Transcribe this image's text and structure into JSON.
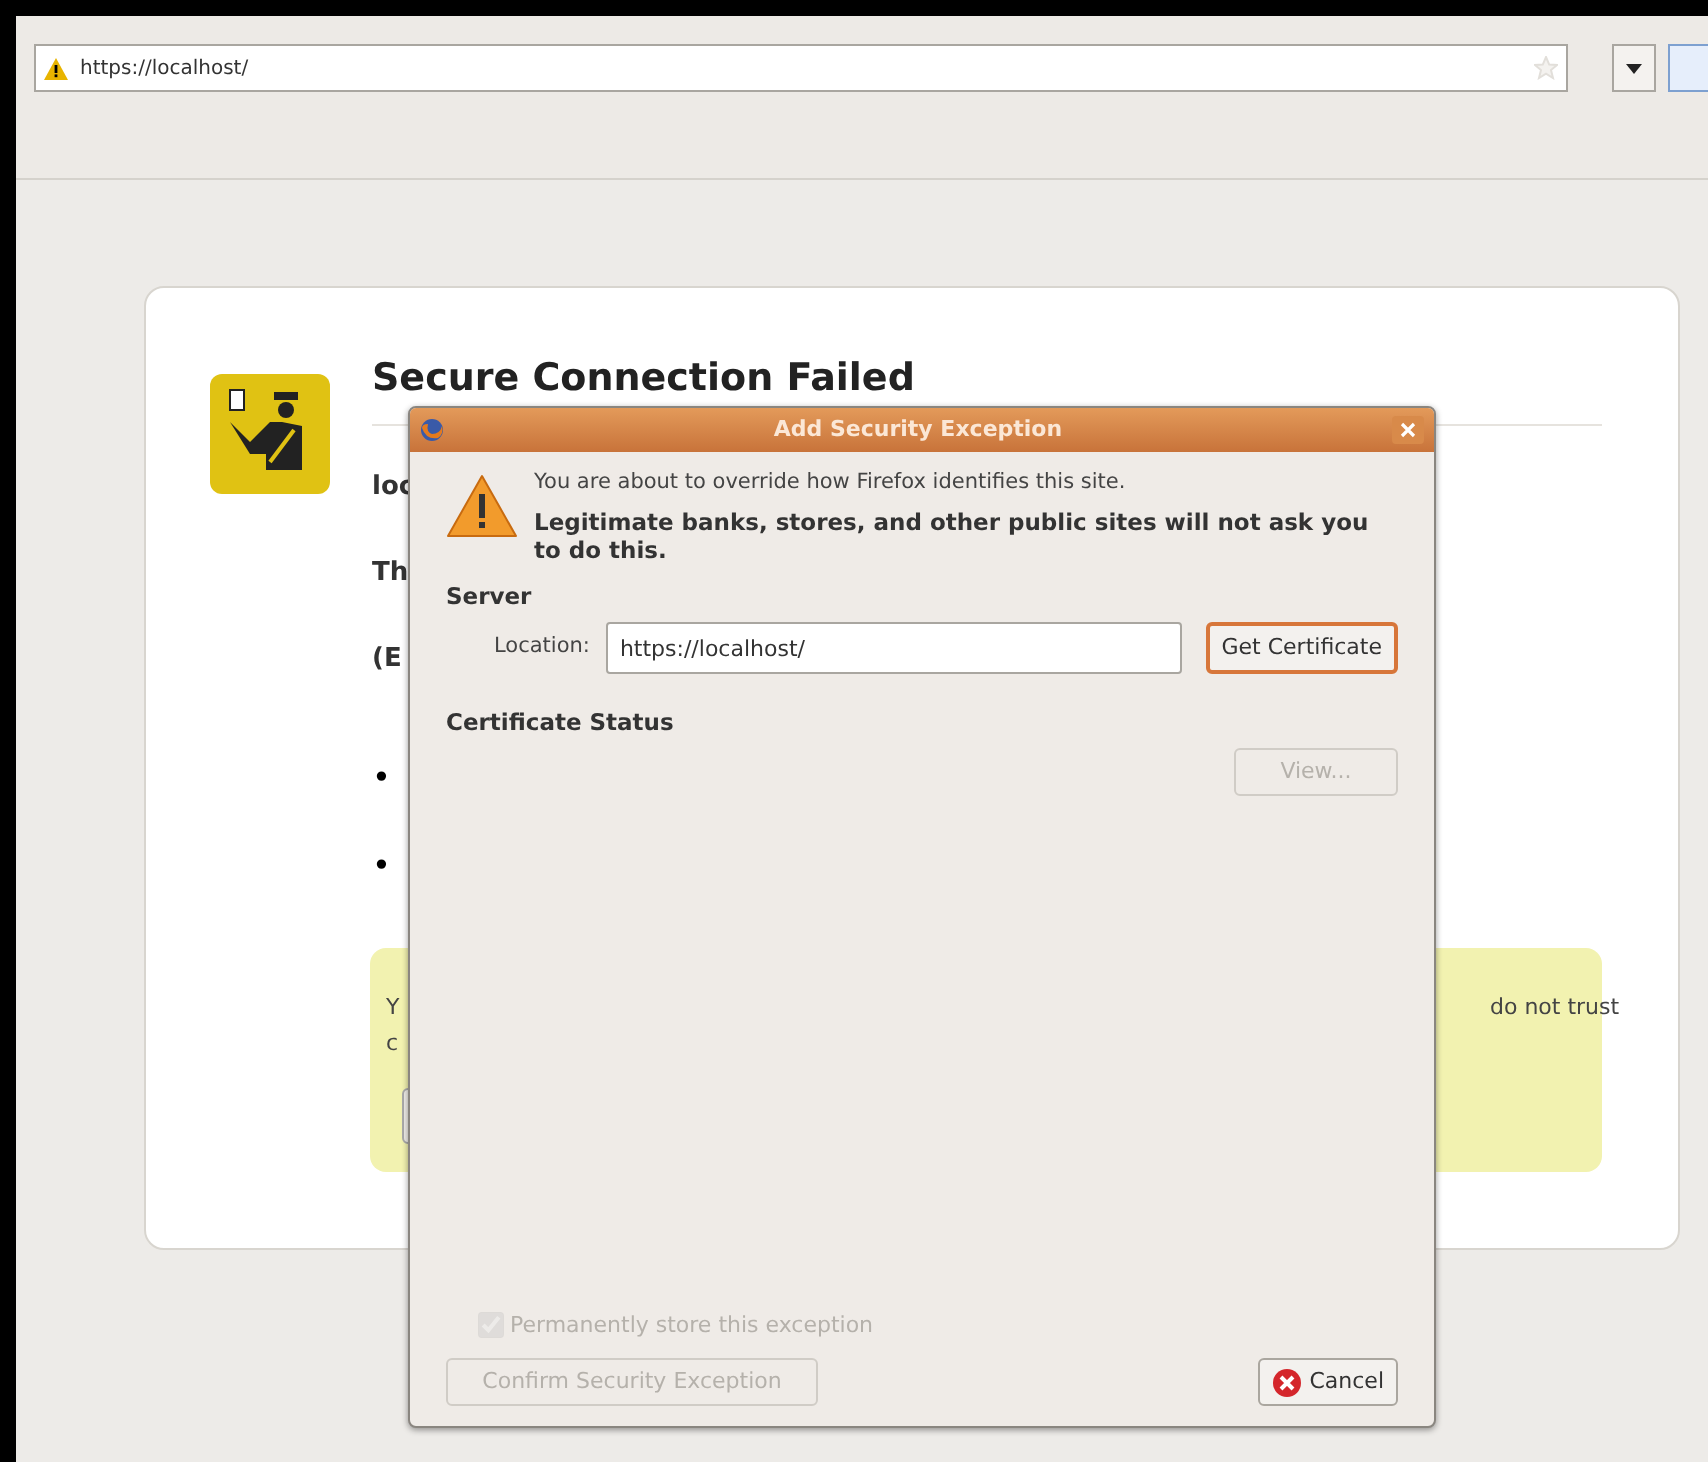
{
  "browser": {
    "url": "https://localhost/"
  },
  "error_page": {
    "title": "Secure Connection Failed",
    "paragraphs": [
      "loc",
      "Th",
      "(E"
    ],
    "bullets": [
      "•",
      "•"
    ],
    "warning_box": {
      "lines": [
        "Y",
        "c"
      ],
      "right_text": "do not trust"
    }
  },
  "dialog": {
    "title": "Add Security Exception",
    "message": "You are about to override how Firefox identifies this site.",
    "warning": "Legitimate banks, stores, and other public sites will not ask you to do this.",
    "server_heading": "Server",
    "location_label": "Location:",
    "location_value": "https://localhost/",
    "get_certificate": {
      "label": "Get Certificate",
      "disabled": false,
      "focused": true
    },
    "status_heading": "Certificate Status",
    "view": {
      "label": "View...",
      "disabled": true,
      "focused": false
    },
    "store": {
      "label": "Permanently store this exception",
      "checked": true,
      "disabled": true
    },
    "confirm": {
      "label": "Confirm Security Exception",
      "disabled": true,
      "focused": false
    },
    "cancel": {
      "label": "Cancel",
      "disabled": false,
      "focused": false
    }
  }
}
